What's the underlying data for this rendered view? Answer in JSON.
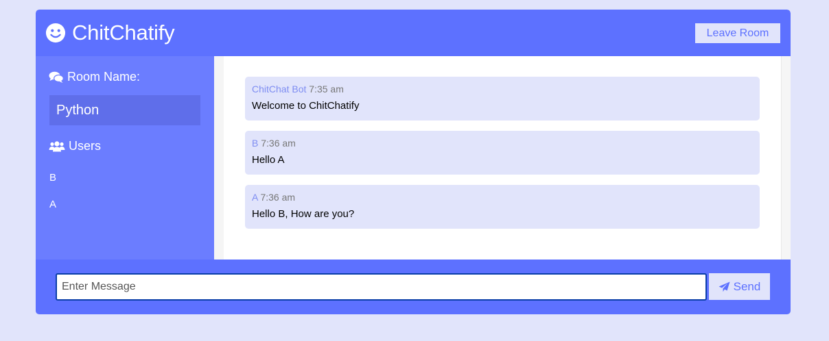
{
  "app": {
    "title": "ChitChatify",
    "logo_icon": "smile-icon",
    "leave_label": "Leave Room"
  },
  "sidebar": {
    "room_heading": "Room Name:",
    "room_icon": "comments-icon",
    "room_name": "Python",
    "users_heading": "Users",
    "users_icon": "users-icon",
    "users": [
      "B",
      "A"
    ]
  },
  "messages": [
    {
      "author": "ChitChat Bot",
      "time": "7:35 am",
      "text": "Welcome to ChitChatify"
    },
    {
      "author": "B",
      "time": "7:36 am",
      "text": "Hello A"
    },
    {
      "author": "A",
      "time": "7:36 am",
      "text": "Hello B, How are you?"
    }
  ],
  "form": {
    "placeholder": "Enter Message",
    "value": "",
    "send_label": "Send",
    "send_icon": "paper-plane-icon"
  },
  "colors": {
    "page_background": "#e1e4fb",
    "header": "#5d71ff",
    "sidebar": "#6b7dff",
    "room_name_bg": "#5f6eea",
    "message_bg": "#e1e4fb",
    "author": "#7e8df2"
  }
}
